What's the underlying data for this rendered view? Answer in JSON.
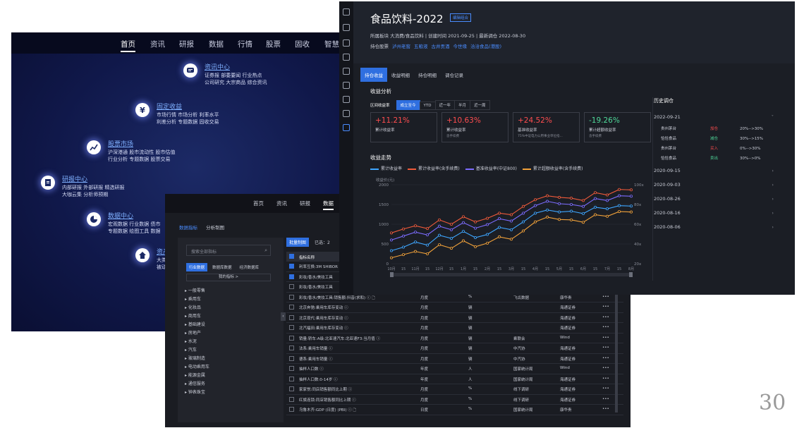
{
  "portal": {
    "nav": [
      "首页",
      "资讯",
      "研报",
      "数据",
      "行情",
      "股票",
      "固收",
      "智慧"
    ],
    "nodes": [
      {
        "title": "资讯中心",
        "lines": [
          "证券报 部委要闻 行业热点",
          "公司研究 大宗商品 综合资讯"
        ],
        "icon": "chat-bubble-icon"
      },
      {
        "title": "固定收益",
        "lines": [
          "市场行情 市场分析 利率水平",
          "利差分析 专题数据 固收交易"
        ],
        "icon": "yen-icon"
      },
      {
        "title": "股票市场",
        "lines": [
          "沪深港通 股市流动性 股市估值",
          "行业分析 专题数据 股票交易"
        ],
        "icon": "trend-icon"
      },
      {
        "title": "研报中心",
        "lines": [
          "内部研报 外部研报 精选研报",
          "大咖云集 分析师预期"
        ],
        "icon": "report-icon"
      },
      {
        "title": "数据中心",
        "lines": [
          "宏观数据 行业数据 债市",
          "专题数据 绘图工具 数据"
        ],
        "icon": "pie-icon"
      },
      {
        "title": "资产",
        "lines": [
          "大类",
          "被动"
        ],
        "icon": "home-icon"
      }
    ]
  },
  "datatool": {
    "nav": [
      "首页",
      "资讯",
      "研报",
      "数据"
    ],
    "subtabs": [
      "数据指标",
      "分析制图"
    ],
    "search_placeholder": "搜索全部指标",
    "filter_tabs": [
      "行业数据",
      "数据库数据",
      "经济数据库"
    ],
    "my_indicators": "我的指标 >",
    "categories": [
      "一般零售",
      "乘用车",
      "化妆品",
      "商用车",
      "基础建设",
      "房地产",
      "水泥",
      "汽车",
      "玻璃制造",
      "电动乘用车",
      "能源金属",
      "通信服务",
      "钟表珠宝"
    ],
    "chart_btn": "批量制图",
    "selected": "已选：2",
    "col_header": "指标名称",
    "rows": [
      {
        "name": "利率互换:3M SHIBOR",
        "freq": "",
        "unit": "",
        "source": "",
        "vendor": "",
        "checked": true
      },
      {
        "name": "彩妆/香水/美妆工具",
        "freq": "",
        "unit": "",
        "source": "",
        "vendor": "",
        "checked": true
      },
      {
        "name": "彩妆/香水/美妆工具",
        "freq": "",
        "unit": "",
        "source": "",
        "vendor": "",
        "checked": false
      },
      {
        "name": "彩妆/香水/美妆工具:销售额:抖音(求和) ⓘ 🗋",
        "freq": "月度",
        "unit": "%",
        "source": "飞瓜数据",
        "vendor": "康华贵",
        "checked": false
      },
      {
        "name": "北京奔驰:乘用车库存变动 ⓘ",
        "freq": "月度",
        "unit": "辆",
        "source": "",
        "vendor": "海通证券",
        "checked": false
      },
      {
        "name": "北京现代:乘用车库存变动 ⓘ",
        "freq": "月度",
        "unit": "辆",
        "source": "",
        "vendor": "海通证券",
        "checked": false
      },
      {
        "name": "北汽福田:乘用车库存变动 ⓘ",
        "freq": "月度",
        "unit": "辆",
        "source": "",
        "vendor": "海通证券",
        "checked": false
      },
      {
        "name": "销量:轿车:A级:北亚速汽车:北亚速F3:当月值 ⓘ",
        "freq": "月度",
        "unit": "辆",
        "source": "乘联会",
        "vendor": "Wind",
        "checked": false
      },
      {
        "name": "法系:乘用车销量 ⓘ",
        "freq": "月度",
        "unit": "辆",
        "source": "中汽协",
        "vendor": "海通证券",
        "checked": false
      },
      {
        "name": "德系:乘用车销量 ⓘ",
        "freq": "月度",
        "unit": "辆",
        "source": "中汽协",
        "vendor": "海通证券",
        "checked": false
      },
      {
        "name": "抽样人口数 ⓘ",
        "freq": "年度",
        "unit": "人",
        "source": "国家统计局",
        "vendor": "Wind",
        "checked": false
      },
      {
        "name": "抽样人口数:0-14岁 ⓘ",
        "freq": "年度",
        "unit": "人",
        "source": "国家统计局",
        "vendor": "海通证券",
        "checked": false
      },
      {
        "name": "家家悦:同店销售额同比上期 ⓘ",
        "freq": "月度",
        "unit": "%",
        "source": "线下调研",
        "vendor": "海通证券",
        "checked": false
      },
      {
        "name": "红旗连锁:同店销售额同比上期 ⓘ",
        "freq": "月度",
        "unit": "%",
        "source": "线下调研",
        "vendor": "海通证券",
        "checked": false
      },
      {
        "name": "乌鲁木齐:GDP (日度) (PBI) ⓘ 🗋",
        "freq": "日度",
        "unit": "%",
        "source": "国家统计局",
        "vendor": "康华贵",
        "checked": false
      }
    ],
    "more": "•••"
  },
  "portfolio": {
    "title": "食品饮料-2022",
    "tag": "编辑组合",
    "meta": "所属板块  大消费/食品饮料  |  创建时间  2021-09-25  |  最新调仓  2022-08-30",
    "holdings_label": "持仓股票",
    "holdings": [
      "泸州老窖",
      "五粮液",
      "古井贡酒",
      "今世缘",
      "洽洽食品(港股)"
    ],
    "tabs": [
      "持仓收益",
      "收益明细",
      "持仓明细",
      "调仓记录"
    ],
    "analysis_title": "收益分析",
    "range_label": "区间收益率",
    "ranges": [
      "成立至今",
      "YTD",
      "近一年",
      "半月",
      "近一周"
    ],
    "kpis": [
      {
        "value": "+11.21%",
        "label": "累计收益率",
        "sub": "",
        "color": "#ff4d4f"
      },
      {
        "value": "+10.63%",
        "label": "累计收益率",
        "sub": "含手续费",
        "color": "#ff4d4f"
      },
      {
        "value": "+24.52%",
        "label": "基准收益率",
        "sub": "75%中证电力公用事业单位指...",
        "color": "#ff4d4f"
      },
      {
        "value": "-19.26%",
        "label": "累计超额收益率",
        "sub": "含手续费",
        "color": "#4fd99a"
      }
    ],
    "trend_title": "收益走势",
    "history_title": "历史调仓",
    "history": [
      {
        "date": "2022-09-21",
        "chev": "˅",
        "trades": [
          {
            "name": "贵州茅台",
            "action": "加仓",
            "color": "#ff4d4f",
            "weight": "20%-->30%"
          },
          {
            "name": "恰恰食品",
            "action": "减仓",
            "color": "#4fd99a",
            "weight": "30%-->15%"
          },
          {
            "name": "贵州茅台",
            "action": "买入",
            "color": "#ff4d4f",
            "weight": "0%-->30%"
          },
          {
            "name": "恰恰食品",
            "action": "卖出",
            "color": "#4fd99a",
            "weight": "30%-->0%"
          }
        ]
      },
      {
        "date": "2020-09-15",
        "chev": "›",
        "trades": []
      },
      {
        "date": "2020-09-03",
        "chev": "›",
        "trades": []
      },
      {
        "date": "2020-08-26",
        "chev": "›",
        "trades": []
      },
      {
        "date": "2020-08-16",
        "chev": "›",
        "trades": []
      },
      {
        "date": "2020-08-06",
        "chev": "›",
        "trades": []
      }
    ]
  },
  "chart_data": {
    "type": "line",
    "ylabel": "收益价(元)",
    "ylim": [
      0,
      2000
    ],
    "y2lim": [
      0,
      100
    ],
    "yticks": [
      0,
      500,
      1000,
      1500,
      2000
    ],
    "y2ticks": [
      "20x",
      "40x",
      "60x",
      "80x",
      "100x"
    ],
    "x": [
      "10月",
      "15",
      "11月",
      "15",
      "12月",
      "15",
      "1月",
      "15",
      "2月",
      "15",
      "3月",
      "15",
      "4月",
      "15",
      "5月",
      "15",
      "6月",
      "15",
      "7月",
      "15",
      "8月"
    ],
    "series": [
      {
        "name": "累计收益率",
        "color": "#3ea6ff",
        "values": [
          330,
          420,
          550,
          470,
          720,
          640,
          820,
          660,
          740,
          920,
          860,
          1060,
          1280,
          1360,
          1310,
          1330,
          1270,
          1430,
          1390,
          1470,
          1460
        ]
      },
      {
        "name": "累计收益率(含手续费)",
        "color": "#f05a3a",
        "values": [
          780,
          880,
          960,
          890,
          1110,
          1000,
          1190,
          1060,
          1150,
          1280,
          1240,
          1450,
          1620,
          1720,
          1680,
          1660,
          1600,
          1800,
          1740,
          1880,
          1870
        ]
      },
      {
        "name": "基准收益率(中证800)",
        "color": "#7c6cff",
        "values": [
          600,
          700,
          800,
          730,
          950,
          860,
          1040,
          900,
          990,
          1140,
          1080,
          1280,
          1470,
          1580,
          1520,
          1500,
          1450,
          1650,
          1600,
          1720,
          1710
        ]
      },
      {
        "name": "累计超额收益率(含手续费)",
        "color": "#f2a23a",
        "values": [
          150,
          230,
          310,
          250,
          480,
          390,
          580,
          430,
          520,
          680,
          620,
          830,
          1060,
          1180,
          1120,
          1110,
          1050,
          1240,
          1200,
          1320,
          1310
        ]
      }
    ]
  },
  "page_number": "30"
}
